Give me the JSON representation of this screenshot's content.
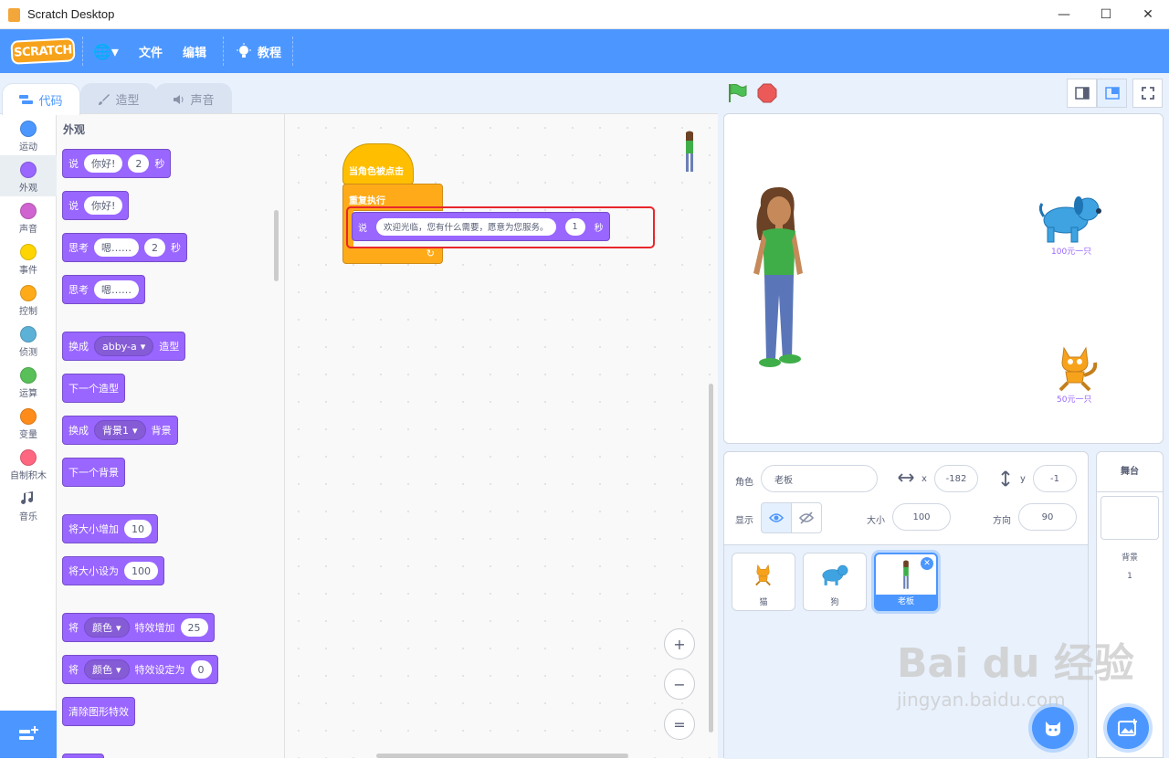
{
  "window": {
    "title": "Scratch Desktop",
    "minimize": "—",
    "maximize": "☐",
    "close": "✕"
  },
  "menubar": {
    "logo": "SCRATCH",
    "language": "🌐▾",
    "file": "文件",
    "edit": "编辑",
    "tutorials": "教程"
  },
  "tabs": {
    "code": "代码",
    "costumes": "造型",
    "sounds": "声音"
  },
  "categories": [
    {
      "label": "运动",
      "color": "#4c97ff"
    },
    {
      "label": "外观",
      "color": "#9966ff"
    },
    {
      "label": "声音",
      "color": "#cf63cf"
    },
    {
      "label": "事件",
      "color": "#ffd500"
    },
    {
      "label": "控制",
      "color": "#ffab19"
    },
    {
      "label": "侦测",
      "color": "#5cb1d6"
    },
    {
      "label": "运算",
      "color": "#59c059"
    },
    {
      "label": "变量",
      "color": "#ff8c1a"
    },
    {
      "label": "自制积木",
      "color": "#ff6680"
    },
    {
      "label": "音乐",
      "color": ""
    }
  ],
  "palette": {
    "title": "外观",
    "blocks": {
      "say_secs": {
        "verb": "说",
        "text": "你好!",
        "secs": "2",
        "unit": "秒"
      },
      "say": {
        "verb": "说",
        "text": "你好!"
      },
      "think_secs": {
        "verb": "思考",
        "text": "嗯……",
        "secs": "2",
        "unit": "秒"
      },
      "think": {
        "verb": "思考",
        "text": "嗯……"
      },
      "switch_costume": {
        "verb": "换成",
        "value": "abby-a",
        "suffix": "造型"
      },
      "next_costume": {
        "label": "下一个造型"
      },
      "switch_backdrop": {
        "verb": "换成",
        "value": "背景1",
        "suffix": "背景"
      },
      "next_backdrop": {
        "label": "下一个背景"
      },
      "change_size": {
        "label": "将大小增加",
        "value": "10"
      },
      "set_size": {
        "label": "将大小设为",
        "value": "100"
      },
      "change_effect": {
        "verb": "将",
        "value": "颜色",
        "suffix": "特效增加",
        "amount": "25"
      },
      "set_effect": {
        "verb": "将",
        "value": "颜色",
        "suffix": "特效设定为",
        "amount": "0"
      },
      "clear_effects": {
        "label": "清除图形特效"
      }
    }
  },
  "script": {
    "hat": "当角色被点击",
    "forever": "重复执行",
    "forever_arrow": "↻",
    "say": {
      "verb": "说",
      "text": "欢迎光临，您有什么需要，愿意为您服务。",
      "secs": "1",
      "unit": "秒"
    }
  },
  "zoom": {
    "in": "+",
    "out": "−",
    "reset": "="
  },
  "stage_labels": {
    "dog": "100元一只",
    "cat": "50元一只"
  },
  "sprite_info": {
    "sprite_label": "角色",
    "sprite_name": "老板",
    "x_label": "x",
    "x": "-182",
    "y_label": "y",
    "y": "-1",
    "show_label": "显示",
    "size_label": "大小",
    "size": "100",
    "direction_label": "方向",
    "direction": "90"
  },
  "sprites": [
    {
      "name": "猫"
    },
    {
      "name": "狗"
    },
    {
      "name": "老板",
      "delete": "✕"
    }
  ],
  "stage_selector": {
    "header": "舞台",
    "backdrops_label": "背景",
    "backdrops_count": "1"
  },
  "watermark": {
    "logo": "Bai du 经验",
    "url": "jingyan.baidu.com"
  },
  "colors": {
    "accent": "#4c97ff",
    "looks": "#9966ff",
    "control": "#ffab19",
    "events": "#ffbf00",
    "highlight": "#e8262b"
  }
}
